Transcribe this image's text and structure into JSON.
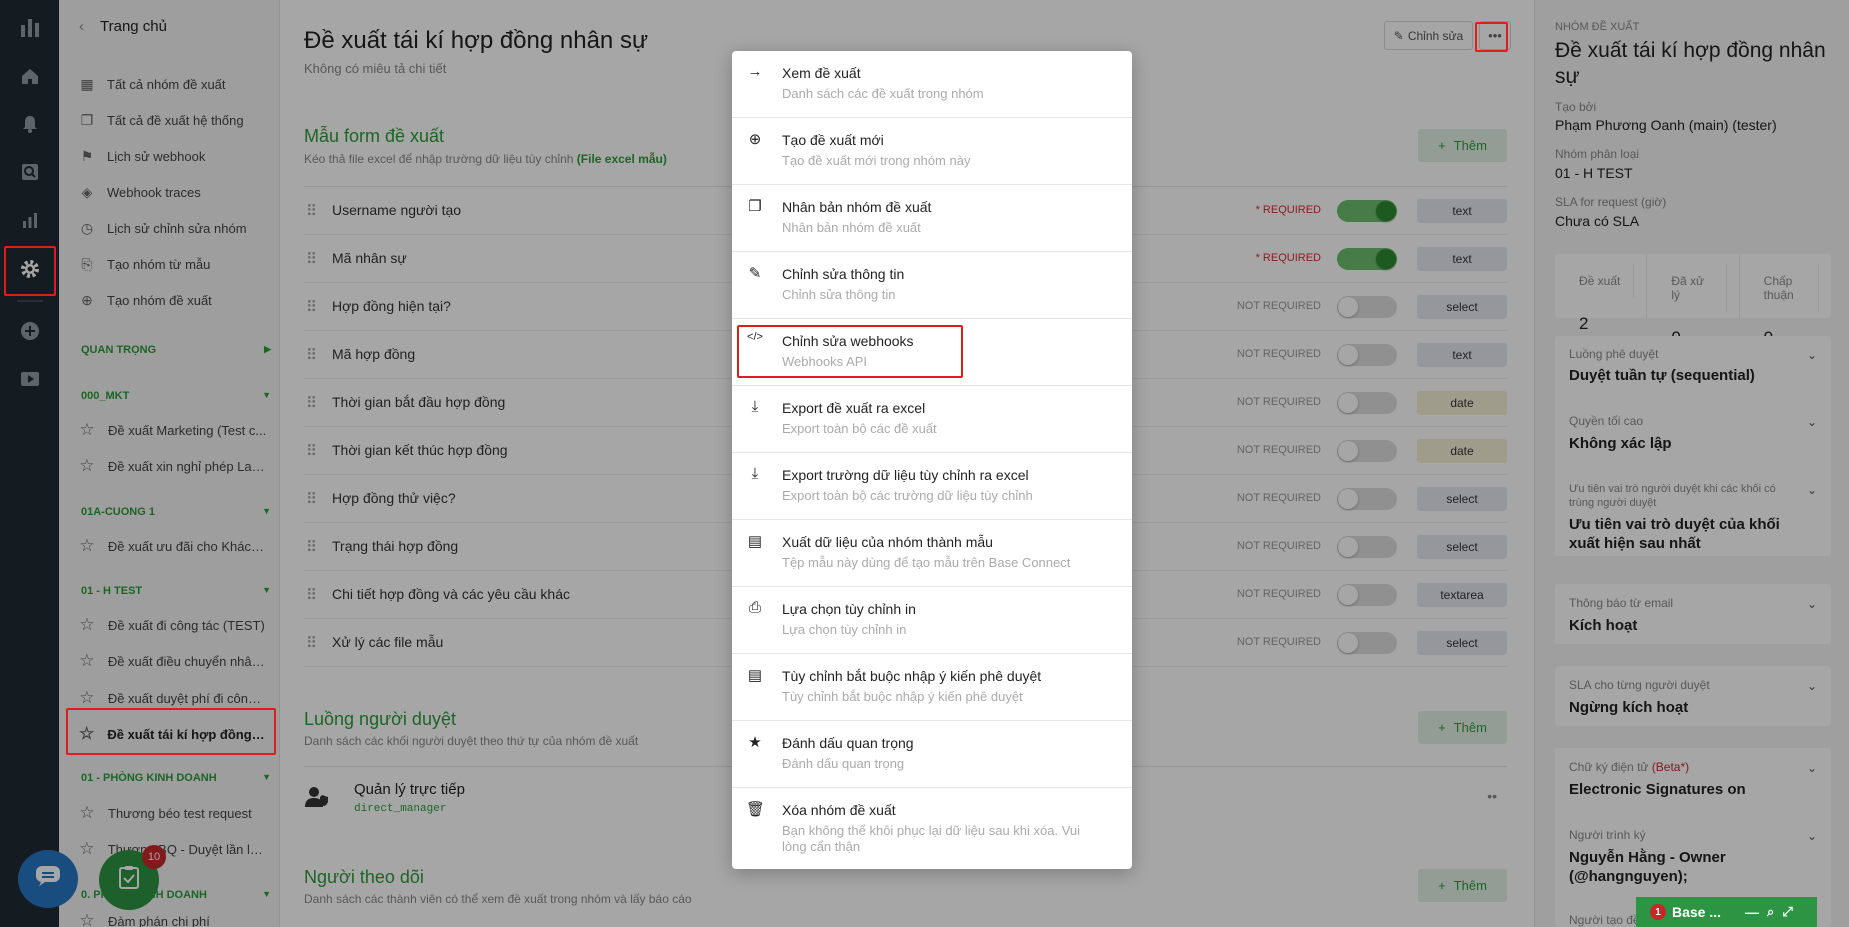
{
  "rail": {
    "icons": [
      "base-logo-icon",
      "home-icon",
      "bell-icon",
      "search-icon",
      "chart-icon",
      "gear-icon",
      "plus-circle-icon",
      "play-icon"
    ]
  },
  "sidebar": {
    "back_label": "Trang chủ",
    "nav": [
      {
        "icon": "grid-icon",
        "glyph": "▦",
        "label": "Tất cả nhóm đề xuất"
      },
      {
        "icon": "copy-icon",
        "glyph": "❐",
        "label": "Tất cả đề xuất hệ thống"
      },
      {
        "icon": "flag-icon",
        "glyph": "⚑",
        "label": "Lịch sử webhook"
      },
      {
        "icon": "layers-icon",
        "glyph": "◈",
        "label": "Webhook traces"
      },
      {
        "icon": "clock-icon",
        "glyph": "◷",
        "label": "Lịch sử chỉnh sửa nhóm"
      },
      {
        "icon": "template-icon",
        "glyph": "⎘",
        "label": "Tạo nhóm từ mẫu"
      },
      {
        "icon": "plus-circle-icon",
        "glyph": "⊕",
        "label": "Tạo nhóm đề xuất"
      }
    ],
    "groups": [
      {
        "name": "QUAN TRỌNG",
        "items": []
      },
      {
        "name": "000_MKT",
        "items": [
          "Đề xuất Marketing (Test c...",
          "Đề xuất xin nghỉ phép Lan..."
        ]
      },
      {
        "name": "01A-CUONG 1",
        "items": [
          "Đề xuất ưu đãi cho Khách..."
        ]
      },
      {
        "name": "01 - H TEST",
        "items": [
          "Đề xuất đi công tác (TEST)",
          "Đề xuất điều chuyển nhân...",
          "Đề xuất duyệt phí đi công ...",
          "Đề xuất tái kí hợp đồng n..."
        ]
      },
      {
        "name": "01 - PHÒNG KINH DOANH",
        "items": [
          "Thương béo test request",
          "Thương BQ - Duyệt lần lượt"
        ]
      },
      {
        "name": "0. PHÒNG KINH DOANH",
        "items": [
          "Đàm phán chi phí"
        ]
      }
    ]
  },
  "main": {
    "title": "Đề xuất tái kí hợp đồng nhân sự",
    "description": "Không có miêu tả chi tiết",
    "edit_label": "Chỉnh sửa",
    "form_section": {
      "title": "Mẫu form đề xuất",
      "desc": "Kéo thả file excel để nhập trường dữ liệu tùy chỉnh",
      "link": "(File excel mẫu)",
      "add_label": "Thêm",
      "fields": [
        {
          "name": "Username người tạo",
          "req": "* REQUIRED",
          "on": true,
          "type": "text"
        },
        {
          "name": "Mã nhân sự",
          "req": "* REQUIRED",
          "on": true,
          "type": "text"
        },
        {
          "name": "Hợp đồng hiện tại?",
          "req": "NOT REQUIRED",
          "on": false,
          "type": "select"
        },
        {
          "name": "Mã hợp đồng",
          "req": "NOT REQUIRED",
          "on": false,
          "type": "text"
        },
        {
          "name": "Thời gian bắt đầu hợp đồng",
          "req": "NOT REQUIRED",
          "on": false,
          "type": "date"
        },
        {
          "name": "Thời gian kết thúc hợp đồng",
          "req": "NOT REQUIRED",
          "on": false,
          "type": "date"
        },
        {
          "name": "Hợp đồng thử việc?",
          "req": "NOT REQUIRED",
          "on": false,
          "type": "select"
        },
        {
          "name": "Trạng thái hợp đồng",
          "req": "NOT REQUIRED",
          "on": false,
          "type": "select"
        },
        {
          "name": "Chi tiết hợp đồng và các yêu cầu khác",
          "req": "NOT REQUIRED",
          "on": false,
          "type": "textarea"
        },
        {
          "name": "Xử lý các file mẫu",
          "req": "NOT REQUIRED",
          "on": false,
          "type": "select"
        }
      ]
    },
    "approval_section": {
      "title": "Luồng người duyệt",
      "desc": "Danh sách các khối người duyệt theo thứ tự của nhóm đề xuất",
      "add_label": "Thêm",
      "approver_name": "Quản lý trực tiếp",
      "approver_code": "direct_manager"
    },
    "followers_section": {
      "title": "Người theo dõi",
      "desc": "Danh sách các thành viên có thể xem đề xuất trong nhóm và lấy báo cáo",
      "add_label": "Thêm"
    }
  },
  "right": {
    "group_label": "NHÓM ĐỀ XUẤT",
    "group_title": "Đề xuất tái kí hợp đồng nhân sự",
    "created_by_label": "Tạo bởi",
    "created_by": "Phạm Phương Oanh (main) (tester)",
    "category_label": "Nhóm phân loại",
    "category": "01 - H TEST",
    "sla_label": "SLA for request (giờ)",
    "sla": "Chưa có SLA",
    "stats": [
      {
        "label": "Đề xuất",
        "value": "2"
      },
      {
        "label": "Đã xử lý",
        "value": "0"
      },
      {
        "label": "Chấp thuận",
        "value": "0"
      }
    ],
    "flow_label": "Luồng phê duyệt",
    "flow": "Duyệt tuần tự (sequential)",
    "top_perm_label": "Quyền tối cao",
    "top_perm": "Không xác lập",
    "priority_label": "Ưu tiên vai trò người duyệt khi các khối có trùng người duyệt",
    "priority": "Ưu tiên vai trò duyệt của khối xuất hiện sau nhất",
    "email_label": "Thông báo từ email",
    "email": "Kích hoạt",
    "sla_each_label": "SLA cho từng người duyệt",
    "sla_each": "Ngừng kích hoạt",
    "esign_label": "Chữ ký điện tử",
    "esign_beta": "(Beta*)",
    "esign": "Electronic Signatures on",
    "presenter_label": "Người trình ký",
    "presenter": "Nguyễn Hằng - Owner (@hangnguyen);",
    "creator_label": "Người tạo đề"
  },
  "menu": {
    "items": [
      {
        "icon": "arrow-right-icon",
        "glyph": "→",
        "title": "Xem đề xuất",
        "sub": "Danh sách các đề xuất trong nhóm"
      },
      {
        "icon": "plus-circle-icon",
        "glyph": "⊕",
        "title": "Tạo đề xuất mới",
        "sub": "Tạo đề xuất mới trong nhóm này"
      },
      {
        "icon": "duplicate-icon",
        "glyph": "❐",
        "title": "Nhân bản nhóm đề xuất",
        "sub": "Nhân bản nhóm đề xuất"
      },
      {
        "icon": "pencil-icon",
        "glyph": "✎",
        "title": "Chỉnh sửa thông tin",
        "sub": "Chỉnh sửa thông tin"
      },
      {
        "icon": "code-icon",
        "glyph": "</>",
        "title": "Chỉnh sửa webhooks",
        "sub": "Webhooks API"
      },
      {
        "icon": "download-icon",
        "glyph": "⤓",
        "title": "Export đề xuất ra excel",
        "sub": "Export toàn bộ các đề xuất"
      },
      {
        "icon": "download-icon",
        "glyph": "⤓",
        "title": "Export trường dữ liệu tùy chỉnh ra excel",
        "sub": "Export toàn bộ các trường dữ liệu tùy chỉnh"
      },
      {
        "icon": "document-icon",
        "glyph": "▤",
        "title": "Xuất dữ liệu của nhóm thành mẫu",
        "sub": "Tệp mẫu này dùng để tạo mẫu trên Base Connect"
      },
      {
        "icon": "printer-icon",
        "glyph": "⎙",
        "title": "Lựa chọn tùy chỉnh in",
        "sub": "Lựa chọn tùy chỉnh in"
      },
      {
        "icon": "document-icon",
        "glyph": "▤",
        "title": "Tùy chỉnh bắt buộc nhập ý kiến phê duyệt",
        "sub": "Tùy chỉnh bắt buộc nhập ý kiến phê duyệt"
      },
      {
        "icon": "star-icon",
        "glyph": "★",
        "title": "Đánh dấu quan trọng",
        "sub": "Đánh dấu quan trọng"
      },
      {
        "icon": "trash-icon",
        "glyph": "🗑",
        "title": "Xóa nhóm đề xuất",
        "sub": "Bạn không thể khôi phục lại dữ liệu sau khi xóa. Vui lòng cẩn thận"
      }
    ]
  },
  "widgets": {
    "task_count": "10",
    "base_badge": "1",
    "base_label": "Base ..."
  },
  "colors": {
    "accent": "#2c9b3a",
    "highlight": "#e01d1d",
    "rail": "#1f2a33"
  }
}
